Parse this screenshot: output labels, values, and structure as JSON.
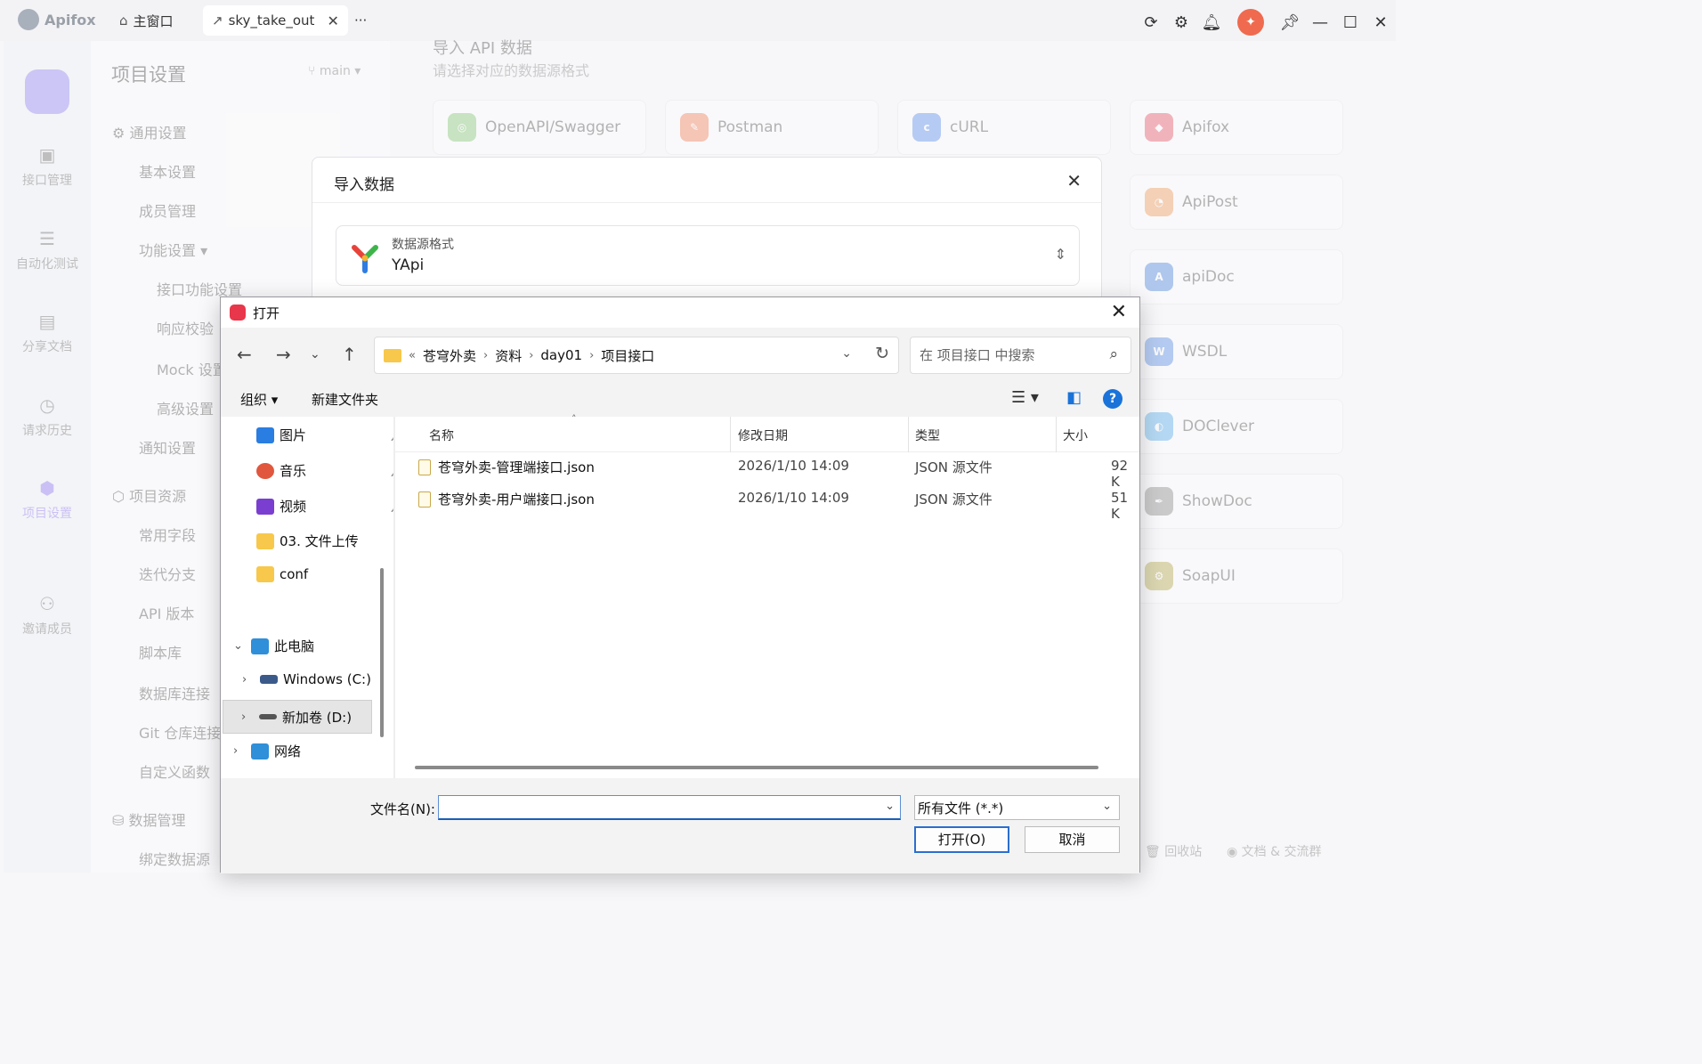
{
  "titlebar": {
    "brand": "Apifox",
    "tabs": [
      {
        "icon": "home-icon",
        "label": "主窗口"
      },
      {
        "icon": "external-link-icon",
        "label": "sky_take_out"
      }
    ],
    "more": "···",
    "avatar": "✦"
  },
  "rail": {
    "items": [
      {
        "label": "接口管理",
        "icon": "api-icon"
      },
      {
        "label": "自动化测试",
        "icon": "automation-icon"
      },
      {
        "label": "分享文档",
        "icon": "book-icon"
      },
      {
        "label": "请求历史",
        "icon": "clock-icon"
      },
      {
        "label": "项目设置",
        "icon": "settings-icon"
      },
      {
        "label": "邀请成员",
        "icon": "add-user-icon"
      }
    ]
  },
  "settings": {
    "title": "项目设置",
    "branch": "main",
    "nav": [
      "通用设置",
      "基本设置",
      "成员管理",
      "功能设置",
      "接口功能设置",
      "响应校验",
      "Mock 设置",
      "高级设置",
      "通知设置",
      "项目资源",
      "常用字段",
      "迭代分支",
      "API 版本",
      "脚本库",
      "数据库连接",
      "Git 仓库连接",
      "自定义函数",
      "数据管理",
      "绑定数据源"
    ]
  },
  "import_page": {
    "title": "导入 API 数据",
    "subtitle": "请选择对应的数据源格式",
    "sources": [
      "OpenAPI/Swagger",
      "Postman",
      "cURL",
      "Apifox",
      "ApiPost",
      "apiDoc",
      "WSDL",
      "DOClever",
      "ShowDoc",
      "SoapUI"
    ],
    "footer": [
      "回收站",
      "文档 & 交流群"
    ]
  },
  "import_modal": {
    "title": "导入数据",
    "format_label": "数据源格式",
    "format_value": "YApi"
  },
  "dialog": {
    "title": "打开",
    "breadcrumb": [
      "苍穹外卖",
      "资料",
      "day01",
      "项目接口"
    ],
    "search_placeholder": "在 项目接口 中搜索",
    "organize": "组织 ▾",
    "new_folder": "新建文件夹",
    "nav": [
      {
        "label": "图片",
        "icon": "pictures-icon",
        "color": "#2a7de1"
      },
      {
        "label": "音乐",
        "icon": "music-icon",
        "color": "#e0573e"
      },
      {
        "label": "视频",
        "icon": "video-icon",
        "color": "#7a3fd0"
      },
      {
        "label": "03. 文件上传",
        "icon": "folder-icon",
        "color": "#f7c84b"
      },
      {
        "label": "conf",
        "icon": "folder-icon",
        "color": "#f7c84b"
      },
      {
        "label": "此电脑",
        "icon": "computer-icon",
        "color": "#2f8fd8"
      },
      {
        "label": "Windows (C:)",
        "icon": "drive-icon",
        "color": "#3b5a8a"
      },
      {
        "label": "新加卷 (D:)",
        "icon": "drive-icon",
        "color": "#555555"
      },
      {
        "label": "网络",
        "icon": "network-icon",
        "color": "#2f8fd8"
      }
    ],
    "columns": [
      "名称",
      "修改日期",
      "类型",
      "大小"
    ],
    "files": [
      {
        "name": "苍穹外卖-管理端接口.json",
        "date": "2026/1/10 14:09",
        "type": "JSON 源文件",
        "size": "92 K"
      },
      {
        "name": "苍穹外卖-用户端接口.json",
        "date": "2026/1/10 14:09",
        "type": "JSON 源文件",
        "size": "51 K"
      }
    ],
    "filename_label": "文件名(N):",
    "filename_value": "",
    "filter_value": "所有文件 (*.*)",
    "open_button": "打开(O)",
    "cancel_button": "取消"
  }
}
